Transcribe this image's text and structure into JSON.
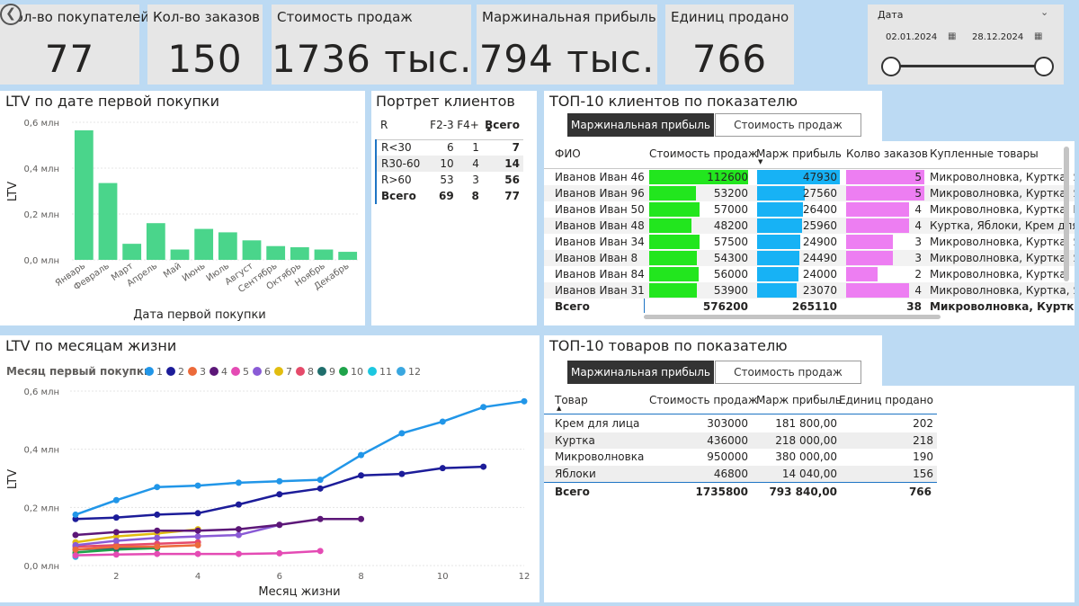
{
  "kpis": [
    {
      "label": "Кол-во покупателей",
      "value": "77"
    },
    {
      "label": "Кол-во заказов",
      "value": "150"
    },
    {
      "label": "Стоимость продаж",
      "value": "1736 тыс."
    },
    {
      "label": "Маржинальная прибыль",
      "value": "794 тыс."
    },
    {
      "label": "Единиц продано",
      "value": "766"
    }
  ],
  "date_slicer": {
    "title": "Дата",
    "from": "02.01.2024",
    "to": "28.12.2024"
  },
  "ltv_first": {
    "title": "LTV по дате первой покупки",
    "xlabel": "Дата первой покупки",
    "ylabel": "LTV",
    "ticks": [
      "0,0 млн",
      "0,2 млн",
      "0,4 млн",
      "0,6 млн"
    ]
  },
  "portrait": {
    "title": "Портрет клиентов",
    "headers": [
      "R",
      "F2-3",
      "F4+",
      "Всего"
    ],
    "rows": [
      [
        "R<30",
        "6",
        "1",
        "7"
      ],
      [
        "R30-60",
        "10",
        "4",
        "14"
      ],
      [
        "R>60",
        "53",
        "3",
        "56"
      ],
      [
        "Всего",
        "69",
        "8",
        "77"
      ]
    ]
  },
  "top_clients": {
    "title": "ТОП-10 клиентов по показателю",
    "btn_on": "Маржинальная прибыль",
    "btn_off": "Стоимость продаж",
    "headers": [
      "ФИО",
      "Стоимость продаж",
      "Марж прибыль",
      "Колво заказов",
      "Купленные товары"
    ],
    "rows": [
      {
        "name": "Иванов Иван 46",
        "sales": "112600",
        "margin": "47930",
        "orders": "5",
        "goods": "Микроволновка, Куртка, Я"
      },
      {
        "name": "Иванов Иван 96",
        "sales": "53200",
        "margin": "27560",
        "orders": "5",
        "goods": "Микроволновка, Куртка, Я"
      },
      {
        "name": "Иванов Иван 50",
        "sales": "57000",
        "margin": "26400",
        "orders": "4",
        "goods": "Микроволновка, Куртка, К"
      },
      {
        "name": "Иванов Иван 48",
        "sales": "48200",
        "margin": "25960",
        "orders": "4",
        "goods": "Куртка, Яблоки, Крем для"
      },
      {
        "name": "Иванов Иван 34",
        "sales": "57500",
        "margin": "24900",
        "orders": "3",
        "goods": "Микроволновка, Куртка, Я"
      },
      {
        "name": "Иванов Иван 8",
        "sales": "54300",
        "margin": "24490",
        "orders": "3",
        "goods": "Микроволновка, Куртка, Я"
      },
      {
        "name": "Иванов Иван 84",
        "sales": "56000",
        "margin": "24000",
        "orders": "2",
        "goods": "Микроволновка, Куртка"
      },
      {
        "name": "Иванов Иван 31",
        "sales": "53900",
        "margin": "23070",
        "orders": "4",
        "goods": "Микроволновка, Куртка, Я"
      }
    ],
    "total": {
      "name": "Всего",
      "sales": "576200",
      "margin": "265110",
      "orders": "38",
      "goods": "Микроволновка, Куртка"
    }
  },
  "ltv_life": {
    "title": "LTV по месяцам жизни",
    "legend_title": "Месяц первый покупки",
    "xlabel": "Месяц жизни",
    "ylabel": "LTV",
    "yticks": [
      "0,0 млн",
      "0,2 млн",
      "0,4 млн",
      "0,6 млн"
    ],
    "xticks": [
      "2",
      "4",
      "6",
      "8",
      "10",
      "12"
    ]
  },
  "top_goods": {
    "title": "ТОП-10 товаров по показателю",
    "btn_on": "Маржинальная прибыль",
    "btn_off": "Стоимость продаж",
    "headers": [
      "Товар",
      "Стоимость продаж",
      "Марж прибыль",
      "Единиц продано"
    ],
    "rows": [
      [
        "Крем для лица",
        "303000",
        "181 800,00",
        "202"
      ],
      [
        "Куртка",
        "436000",
        "218 000,00",
        "218"
      ],
      [
        "Микроволновка",
        "950000",
        "380 000,00",
        "190"
      ],
      [
        "Яблоки",
        "46800",
        "14 040,00",
        "156"
      ]
    ],
    "total": [
      "Всего",
      "1735800",
      "793 840,00",
      "766"
    ]
  },
  "chart_data": [
    {
      "type": "bar",
      "title": "LTV по дате первой покупки",
      "xlabel": "Дата первой покупки",
      "ylabel": "LTV",
      "categories": [
        "Январь",
        "Февраль",
        "Март",
        "Апрель",
        "Май",
        "Июнь",
        "Июль",
        "Август",
        "Сентябрь",
        "Октябрь",
        "Ноябрь",
        "Декабрь"
      ],
      "values": [
        0.565,
        0.335,
        0.07,
        0.16,
        0.045,
        0.135,
        0.12,
        0.085,
        0.06,
        0.055,
        0.045,
        0.035
      ],
      "units": "млн",
      "ylim": [
        0,
        0.6
      ],
      "color": "#4ad58b"
    },
    {
      "type": "line",
      "title": "LTV по месяцам жизни",
      "xlabel": "Месяц жизни",
      "ylabel": "LTV",
      "units": "млн",
      "ylim": [
        0,
        0.6
      ],
      "xlim": [
        1,
        12
      ],
      "series": [
        {
          "name": "1",
          "color": "#2196e8",
          "x": [
            1,
            2,
            3,
            4,
            5,
            6,
            7,
            8,
            9,
            10,
            11,
            12
          ],
          "values": [
            0.175,
            0.225,
            0.27,
            0.275,
            0.285,
            0.29,
            0.295,
            0.38,
            0.455,
            0.495,
            0.545,
            0.565
          ]
        },
        {
          "name": "2",
          "color": "#1c1c99",
          "x": [
            1,
            2,
            3,
            4,
            5,
            6,
            7,
            8,
            9,
            10,
            11
          ],
          "values": [
            0.16,
            0.165,
            0.175,
            0.18,
            0.21,
            0.245,
            0.265,
            0.31,
            0.315,
            0.335,
            0.34
          ]
        },
        {
          "name": "3",
          "color": "#ec6a3a",
          "x": [
            1,
            2,
            3,
            4
          ],
          "values": [
            0.055,
            0.065,
            0.065,
            0.07
          ]
        },
        {
          "name": "4",
          "color": "#5c1778",
          "x": [
            1,
            2,
            3,
            4,
            5,
            6,
            7,
            8
          ],
          "values": [
            0.105,
            0.115,
            0.12,
            0.12,
            0.125,
            0.14,
            0.16,
            0.16
          ]
        },
        {
          "name": "5",
          "color": "#e44bb4",
          "x": [
            1,
            2,
            3,
            4,
            5,
            6,
            7
          ],
          "values": [
            0.035,
            0.038,
            0.04,
            0.04,
            0.04,
            0.042,
            0.05
          ]
        },
        {
          "name": "6",
          "color": "#8a5bd6",
          "x": [
            1,
            2,
            3,
            4,
            5,
            6
          ],
          "values": [
            0.07,
            0.085,
            0.095,
            0.1,
            0.105,
            0.14
          ]
        },
        {
          "name": "7",
          "color": "#e2bd0f",
          "x": [
            1,
            2,
            3,
            4
          ],
          "values": [
            0.08,
            0.1,
            0.11,
            0.125
          ]
        },
        {
          "name": "8",
          "color": "#e54a6a",
          "x": [
            1,
            2,
            3,
            4
          ],
          "values": [
            0.065,
            0.07,
            0.075,
            0.08
          ]
        },
        {
          "name": "9",
          "color": "#1f6e6c",
          "x": [
            1,
            2,
            3
          ],
          "values": [
            0.055,
            0.06,
            0.065
          ]
        },
        {
          "name": "10",
          "color": "#1fa34a",
          "x": [
            1,
            2,
            3
          ],
          "values": [
            0.045,
            0.055,
            0.06
          ]
        },
        {
          "name": "11",
          "color": "#1cc7e0",
          "x": [
            1
          ],
          "values": [
            0.04
          ]
        },
        {
          "name": "12",
          "color": "#3aa7e0",
          "x": [
            1
          ],
          "values": [
            0.03
          ]
        }
      ]
    }
  ]
}
